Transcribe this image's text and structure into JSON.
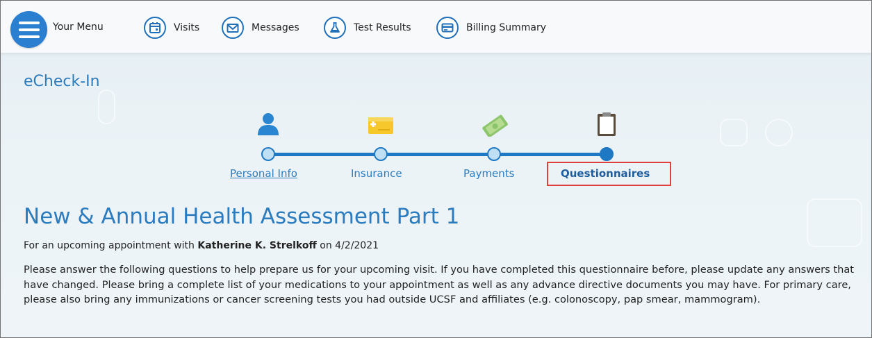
{
  "nav": {
    "menu_label": "Your Menu",
    "items": [
      {
        "label": "Visits",
        "icon": "calendar-icon"
      },
      {
        "label": "Messages",
        "icon": "envelope-icon"
      },
      {
        "label": "Test Results",
        "icon": "flask-icon"
      },
      {
        "label": "Billing Summary",
        "icon": "credit-card-icon"
      }
    ]
  },
  "page": {
    "title": "eCheck-In"
  },
  "progress": {
    "steps": [
      {
        "label": "Personal Info",
        "icon": "person-icon",
        "state": "completed"
      },
      {
        "label": "Insurance",
        "icon": "insurance-card-icon",
        "state": "completed"
      },
      {
        "label": "Payments",
        "icon": "money-icon",
        "state": "completed"
      },
      {
        "label": "Questionnaires",
        "icon": "clipboard-icon",
        "state": "current"
      }
    ]
  },
  "questionnaire": {
    "heading": "New & Annual Health Assessment Part 1",
    "appointment_prefix": "For an upcoming appointment with",
    "provider": "Katherine K. Strelkoff",
    "date_prefix": "on",
    "date": "4/2/2021",
    "instructions": "Please answer the following questions to help prepare us for your upcoming visit. If you have completed this questionnaire before, please update any answers that have changed. Please bring a complete list of your medications to your appointment as well as any advance directive documents you may have. For primary care, please also bring any immunizations or cancer screening tests you had outside UCSF and affiliates (e.g. colonoscopy, pap smear, mammogram)."
  },
  "colors": {
    "accent": "#2b7bbf",
    "track": "#1f78c4",
    "highlight": "#e0403a"
  }
}
